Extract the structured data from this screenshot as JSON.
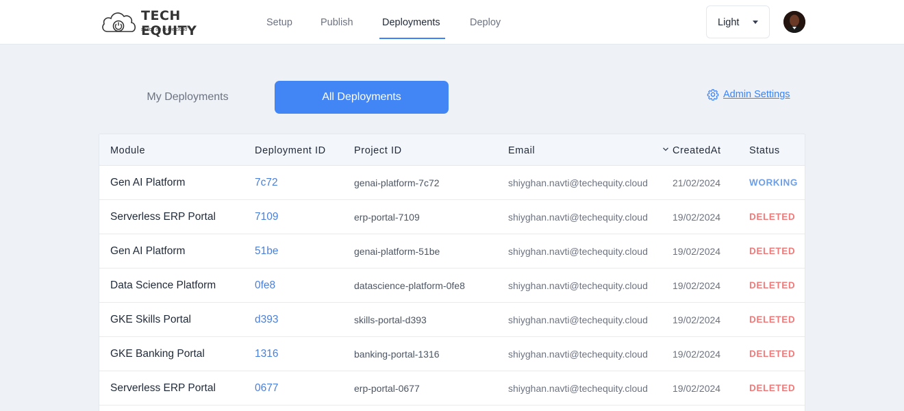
{
  "brand": {
    "title": "TECH EQUITY",
    "tagline": "switch on to the cloud"
  },
  "nav": {
    "items": [
      {
        "label": "Setup"
      },
      {
        "label": "Publish"
      },
      {
        "label": "Deployments",
        "active": true
      },
      {
        "label": "Deploy"
      }
    ]
  },
  "theme": {
    "selected": "Light"
  },
  "tabs": {
    "my_deployments": "My Deployments",
    "all_deployments": "All Deployments"
  },
  "admin": {
    "label": "Admin Settings"
  },
  "table": {
    "columns": {
      "module": "Module",
      "deployment_id": "Deployment ID",
      "project_id": "Project ID",
      "email": "Email",
      "created_at": "CreatedAt",
      "status": "Status"
    },
    "rows": [
      {
        "module": "Gen AI Platform",
        "deployment_id": "7c72",
        "project_id": "genai-platform-7c72",
        "email": "shiyghan.navti@techequity.cloud",
        "created_at": "21/02/2024",
        "status": "WORKING"
      },
      {
        "module": "Serverless ERP Portal",
        "deployment_id": "7109",
        "project_id": "erp-portal-7109",
        "email": "shiyghan.navti@techequity.cloud",
        "created_at": "19/02/2024",
        "status": "DELETED"
      },
      {
        "module": "Gen AI Platform",
        "deployment_id": "51be",
        "project_id": "genai-platform-51be",
        "email": "shiyghan.navti@techequity.cloud",
        "created_at": "19/02/2024",
        "status": "DELETED"
      },
      {
        "module": "Data Science Platform",
        "deployment_id": "0fe8",
        "project_id": "datascience-platform-0fe8",
        "email": "shiyghan.navti@techequity.cloud",
        "created_at": "19/02/2024",
        "status": "DELETED"
      },
      {
        "module": "GKE Skills Portal",
        "deployment_id": "d393",
        "project_id": "skills-portal-d393",
        "email": "shiyghan.navti@techequity.cloud",
        "created_at": "19/02/2024",
        "status": "DELETED"
      },
      {
        "module": "GKE Banking Portal",
        "deployment_id": "1316",
        "project_id": "banking-portal-1316",
        "email": "shiyghan.navti@techequity.cloud",
        "created_at": "19/02/2024",
        "status": "DELETED"
      },
      {
        "module": "Serverless ERP Portal",
        "deployment_id": "0677",
        "project_id": "erp-portal-0677",
        "email": "shiyghan.navti@techequity.cloud",
        "created_at": "19/02/2024",
        "status": "DELETED"
      }
    ]
  },
  "colors": {
    "accent": "#4285f4",
    "working": "#6d9fe6",
    "deleted": "#f07a7a"
  }
}
